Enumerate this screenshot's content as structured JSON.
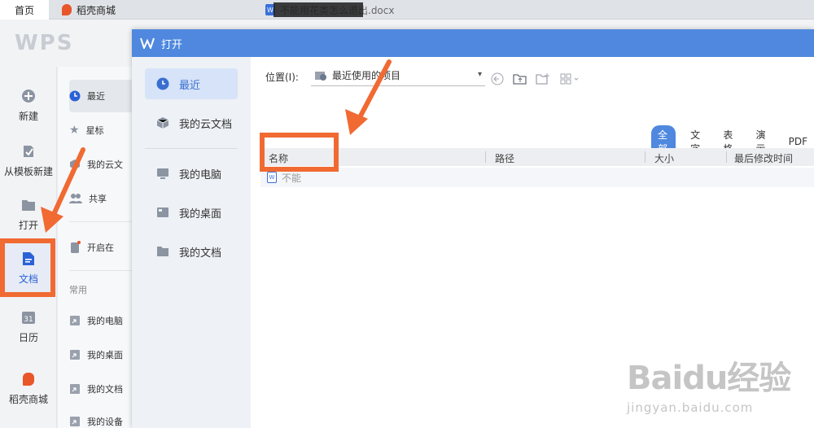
{
  "tabs": {
    "home": "首页",
    "store": "稻壳商城",
    "doc": "不能用花类怎么退出.docx"
  },
  "brand": "WPS",
  "left_nav": [
    {
      "label": "新建",
      "icon": "plus-circle-icon"
    },
    {
      "label": "从模板新建",
      "icon": "template-icon"
    },
    {
      "label": "打开",
      "icon": "folder-icon"
    },
    {
      "label": "文档",
      "icon": "document-icon"
    },
    {
      "label": "日历",
      "icon": "calendar-icon"
    },
    {
      "label": "稻壳商城",
      "icon": "daoke-icon"
    }
  ],
  "col2": {
    "items": [
      {
        "label": "最近",
        "icon": "clock-icon"
      },
      {
        "label": "星标",
        "icon": "star-icon"
      },
      {
        "label": "我的云文",
        "icon": "cloud-box-icon"
      },
      {
        "label": "共享",
        "icon": "share-icon"
      },
      {
        "label": "开启在",
        "icon": "phone-icon"
      }
    ],
    "section": "常用",
    "common": [
      {
        "label": "我的电脑",
        "icon": "computer-shortcut-icon"
      },
      {
        "label": "我的桌面",
        "icon": "desktop-shortcut-icon"
      },
      {
        "label": "我的文档",
        "icon": "doc-shortcut-icon"
      },
      {
        "label": "我的设备",
        "icon": "device-shortcut-icon"
      }
    ]
  },
  "dialog": {
    "title": "打开",
    "sidebar": [
      {
        "label": "最近",
        "icon": "clock-icon"
      },
      {
        "label": "我的云文档",
        "icon": "cloud-box-icon"
      },
      {
        "label": "我的电脑",
        "icon": "monitor-icon"
      },
      {
        "label": "我的桌面",
        "icon": "desktop-icon"
      },
      {
        "label": "我的文档",
        "icon": "folder-icon"
      }
    ],
    "location_label": "位置(I):",
    "location_value": "最近使用的项目",
    "filters": [
      "全部",
      "文字",
      "表格",
      "演示",
      "PDF"
    ],
    "columns": [
      "名称",
      "路径",
      "大小",
      "最后修改时间"
    ],
    "files": [
      {
        "name": "不能"
      }
    ]
  },
  "watermark": {
    "main": "Baidu经验",
    "sub": "jingyan.baidu.com"
  },
  "colors": {
    "accent": "#4f88de",
    "annotation": "#f06a32"
  }
}
